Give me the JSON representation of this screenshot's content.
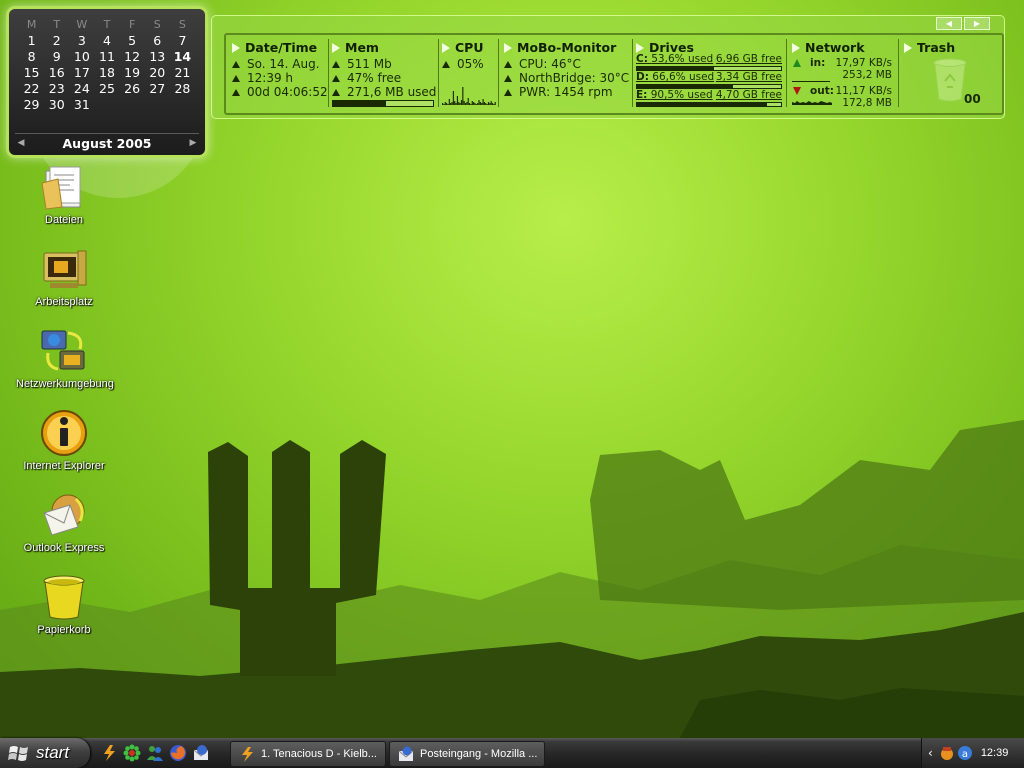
{
  "calendar": {
    "weekdays": [
      "M",
      "T",
      "W",
      "T",
      "F",
      "S",
      "S"
    ],
    "weeks": [
      [
        "1",
        "2",
        "3",
        "4",
        "5",
        "6",
        "7"
      ],
      [
        "8",
        "9",
        "10",
        "11",
        "12",
        "13",
        "14"
      ],
      [
        "15",
        "16",
        "17",
        "18",
        "19",
        "20",
        "21"
      ],
      [
        "22",
        "23",
        "24",
        "25",
        "26",
        "27",
        "28"
      ],
      [
        "29",
        "30",
        "31",
        "",
        "",
        "",
        ""
      ]
    ],
    "today": "14",
    "month_label": "August 2005"
  },
  "monitor": {
    "datetime": {
      "title": "Date/Time",
      "date": "So. 14. Aug.",
      "time": "12:39 h",
      "uptime": "00d 04:06:52"
    },
    "mem": {
      "title": "Mem",
      "total": "511 Mb",
      "free": "47% free",
      "used": "271,6 MB used",
      "used_fraction": 0.53
    },
    "cpu": {
      "title": "CPU",
      "load": "05%",
      "history": [
        2,
        1,
        3,
        2,
        1,
        6,
        2,
        3,
        14,
        4,
        2,
        9,
        3,
        2,
        5,
        18,
        4,
        2,
        3,
        7,
        2,
        1,
        4,
        3,
        2,
        1,
        2,
        5,
        3,
        2,
        6,
        3,
        2,
        1,
        3,
        2,
        4,
        2,
        1,
        3
      ]
    },
    "mobo": {
      "title": "MoBo-Monitor",
      "cpu_temp": "CPU: 46°C",
      "nb_temp": "NorthBridge: 30°C",
      "fan": "PWR: 1454 rpm"
    },
    "drives": {
      "title": "Drives",
      "items": [
        {
          "name": "C:",
          "used": "53,6% used",
          "free": "6,96 GB free",
          "fraction": 0.536
        },
        {
          "name": "D:",
          "used": "66,6% used",
          "free": "3,34 GB free",
          "fraction": 0.666
        },
        {
          "name": "E:",
          "used": "90,5% used",
          "free": "4,70 GB free",
          "fraction": 0.905
        }
      ]
    },
    "network": {
      "title": "Network",
      "in_label": "in:",
      "in_rate": "17,97 KB/s",
      "in_total": "253,2 MB",
      "out_label": "out:",
      "out_rate": "11,17 KB/s",
      "out_total": "172,8 MB"
    },
    "trash": {
      "title": "Trash",
      "count": "00"
    }
  },
  "desktop_icons": [
    {
      "label": "Dateien",
      "icon": "folder-documents-icon"
    },
    {
      "label": "Arbeitsplatz",
      "icon": "my-computer-icon"
    },
    {
      "label": "Netzwerkumgebung",
      "icon": "network-places-icon"
    },
    {
      "label": "Internet Explorer",
      "icon": "info-globe-icon"
    },
    {
      "label": "Outlook Express",
      "icon": "mail-icon"
    },
    {
      "label": "Papierkorb",
      "icon": "recycle-bin-icon"
    }
  ],
  "taskbar": {
    "start_label": "start",
    "tasks": [
      {
        "label": "1. Tenacious D - Kielb...",
        "icon": "winamp-icon"
      },
      {
        "label": "Posteingang - Mozilla ...",
        "icon": "thunderbird-icon"
      }
    ],
    "clock": "12:39"
  },
  "colors": {
    "desktop_green": "#98d82e",
    "dark_silhouette": "#2c4208",
    "monitor_text": "#1a2a00"
  }
}
